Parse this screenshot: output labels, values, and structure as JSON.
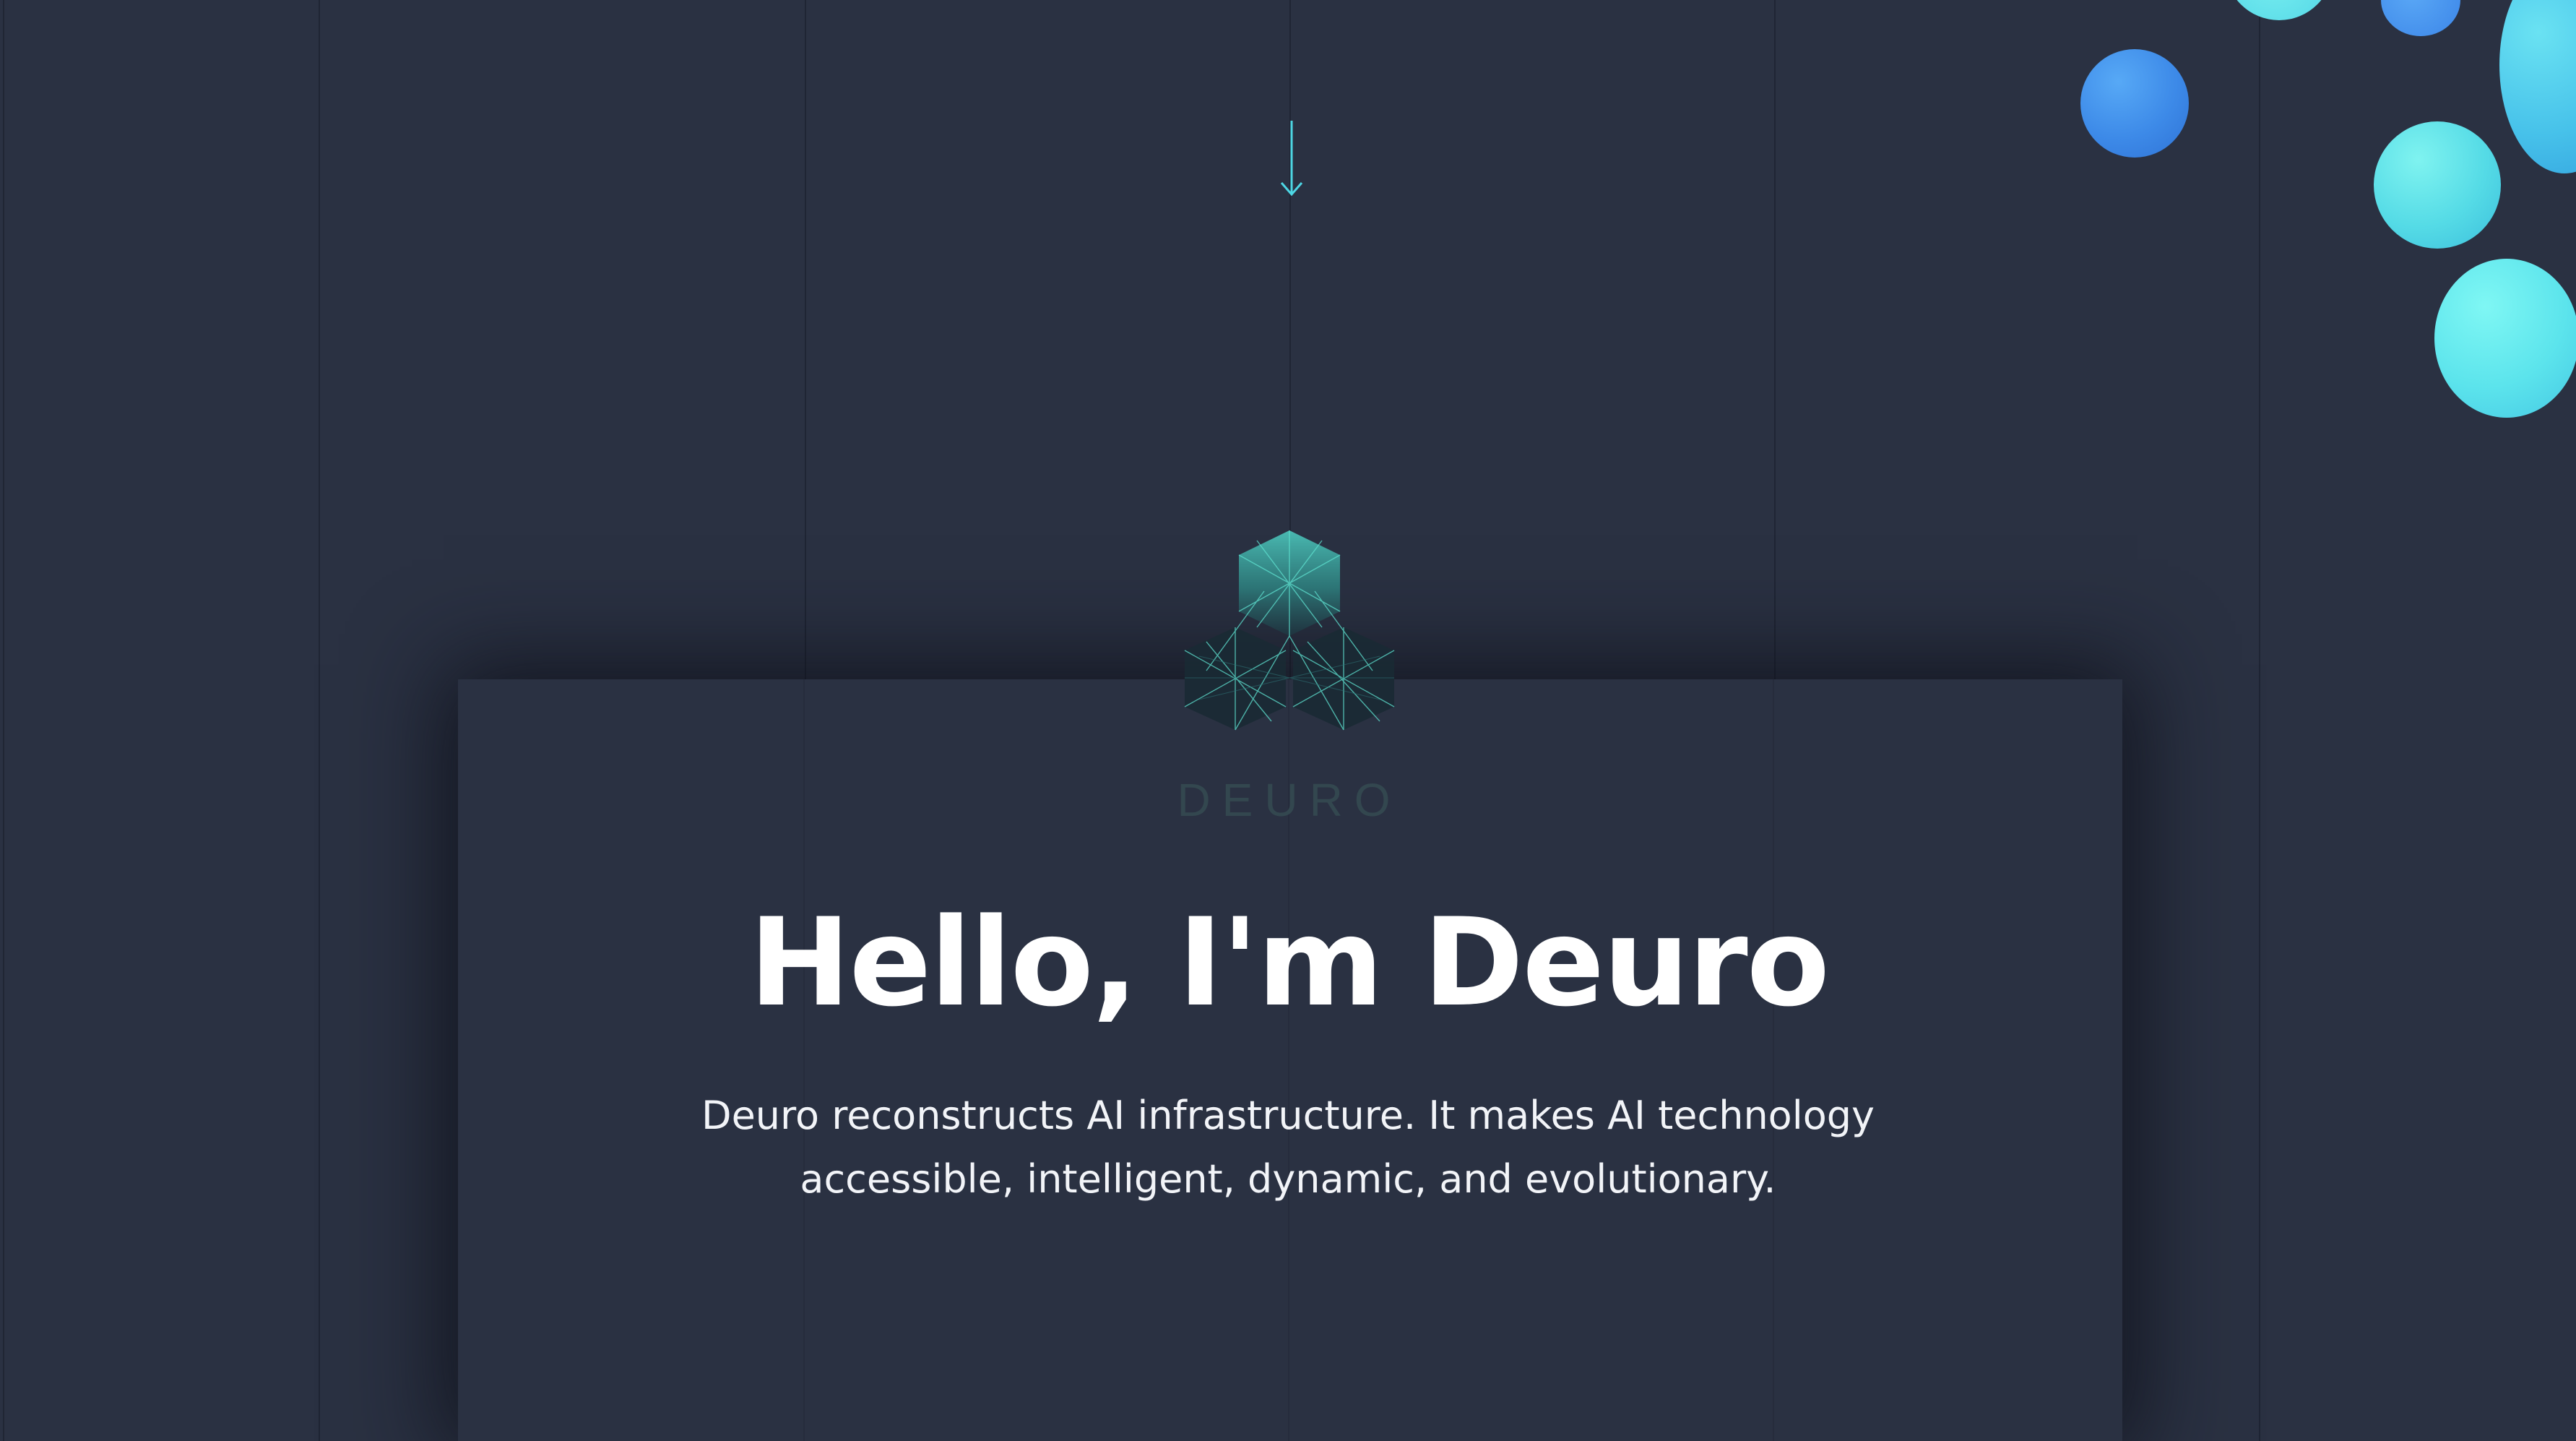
{
  "hero": {
    "title": "Hello, I'm Deuro",
    "description": "Deuro reconstructs AI infrastructure. It makes AI technology accessible, intelligent, dynamic, and evolutionary."
  },
  "logo": {
    "wordmark": "DEURO",
    "colors": {
      "mesh": "#4fd1c5",
      "wordmark": "#33474f"
    }
  },
  "icons": {
    "scroll_arrow": "arrow-down-icon"
  },
  "colors": {
    "background": "#2a3142",
    "card": "#2a3142",
    "accent": "#4dd6e4",
    "bubble_blue": "#3d8ae8",
    "bubble_cyan": "#55dbe6",
    "text": "#ffffff"
  }
}
